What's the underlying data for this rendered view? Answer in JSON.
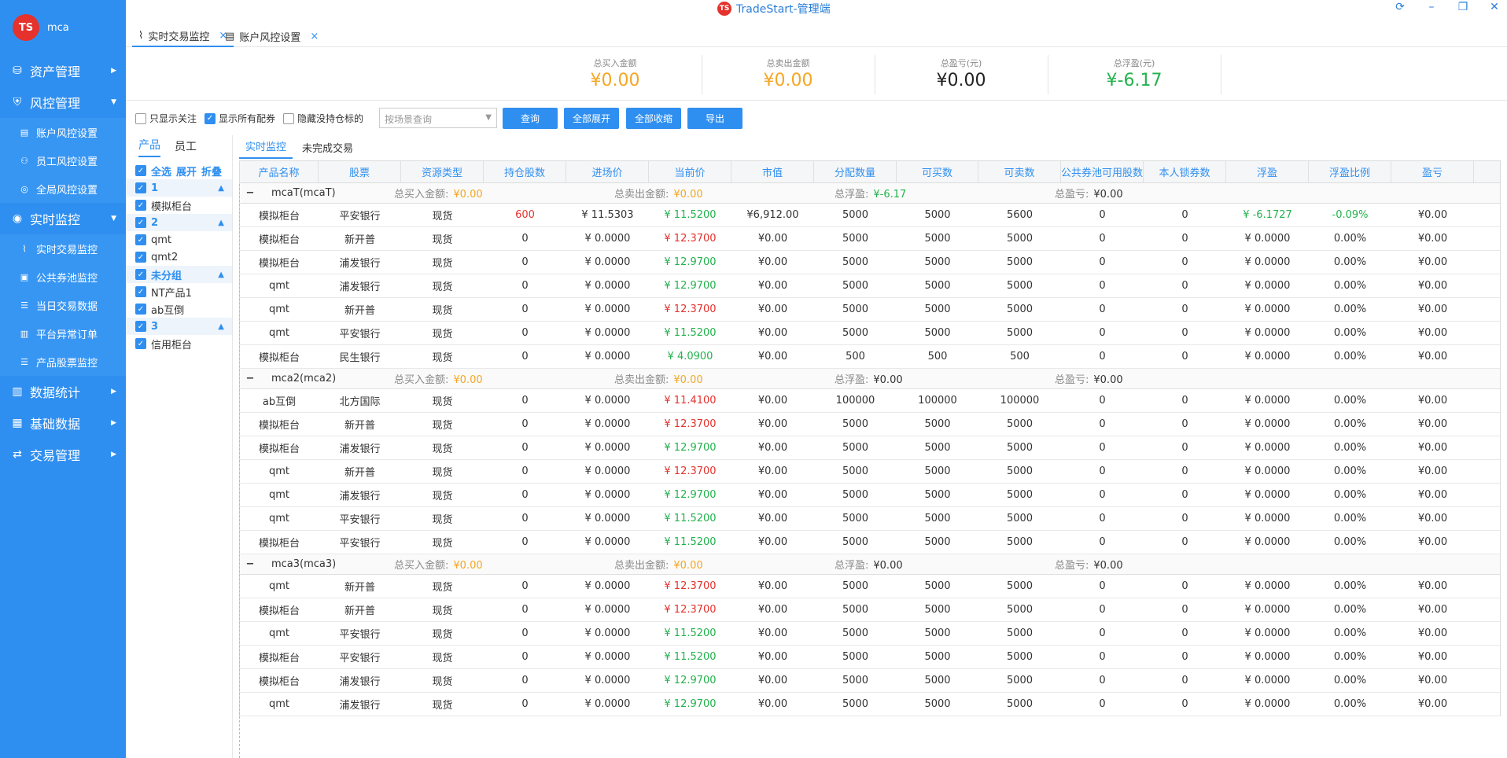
{
  "window": {
    "title": "TradeStart-管理端",
    "logo": "TS",
    "controls": [
      "refresh-icon",
      "minimize-icon",
      "restore-icon",
      "close-icon"
    ],
    "control_glyphs": [
      "⟳",
      "–",
      "❐",
      "✕"
    ]
  },
  "brand": {
    "logo": "TS",
    "name": "mca"
  },
  "sidebar": {
    "groups": [
      {
        "label": "资产管理",
        "icon": "wallet-icon",
        "glyph": "⛁",
        "arrow": "▶",
        "items": []
      },
      {
        "label": "风控管理",
        "icon": "shield-icon",
        "glyph": "⛨",
        "arrow": "▼",
        "items": [
          {
            "label": "账户风控设置",
            "icon": "list-icon",
            "glyph": "▤"
          },
          {
            "label": "员工风控设置",
            "icon": "user-icon",
            "glyph": "⚇"
          },
          {
            "label": "全局风控设置",
            "icon": "globe-icon",
            "glyph": "◎"
          }
        ]
      },
      {
        "label": "实时监控",
        "icon": "monitor-icon",
        "glyph": "◉",
        "arrow": "▼",
        "items": [
          {
            "label": "实时交易监控",
            "icon": "line-chart-icon",
            "glyph": "⌇"
          },
          {
            "label": "公共券池监控",
            "icon": "chart-icon",
            "glyph": "▣"
          },
          {
            "label": "当日交易数据",
            "icon": "list-icon",
            "glyph": "☰"
          },
          {
            "label": "平台异常订单",
            "icon": "order-icon",
            "glyph": "▥"
          },
          {
            "label": "产品股票监控",
            "icon": "list-icon",
            "glyph": "☰"
          }
        ]
      },
      {
        "label": "数据统计",
        "icon": "bar-chart-icon",
        "glyph": "▥",
        "arrow": "▶",
        "items": []
      },
      {
        "label": "基础数据",
        "icon": "database-icon",
        "glyph": "▦",
        "arrow": "▶",
        "items": []
      },
      {
        "label": "交易管理",
        "icon": "exchange-icon",
        "glyph": "⇄",
        "arrow": "▶",
        "items": []
      }
    ]
  },
  "tabs": [
    {
      "label": "实时交易监控",
      "icon": "line-chart-icon",
      "glyph": "⌇",
      "close": "×"
    },
    {
      "label": "账户风控设置",
      "icon": "list-icon",
      "glyph": "▤",
      "close": "×"
    }
  ],
  "summary": [
    {
      "label": "总买入金额",
      "value": "¥0.00",
      "color": "#f5a623"
    },
    {
      "label": "总卖出金额",
      "value": "¥0.00",
      "color": "#f5a623"
    },
    {
      "label": "总盈亏(元)",
      "value": "¥0.00",
      "color": "#222222"
    },
    {
      "label": "总浮盈(元)",
      "value": "¥-6.17",
      "color": "#22b24c"
    }
  ],
  "toolbar": {
    "checks": [
      {
        "label": "只显示关注",
        "checked": false
      },
      {
        "label": "显示所有配券",
        "checked": true
      },
      {
        "label": "隐藏没持仓标的",
        "checked": false
      }
    ],
    "select_placeholder": "按场景查询",
    "select_caret": "▼",
    "check_glyph": "✓",
    "buttons": [
      "查询",
      "全部展开",
      "全部收缩",
      "导出"
    ]
  },
  "filter": {
    "tabs": [
      "产品",
      "员工"
    ],
    "top": {
      "all": "全选",
      "expand": "展开",
      "collapse": "折叠"
    },
    "group_caret": "▲",
    "groups": [
      {
        "name": "1",
        "items": [
          "模拟柜台"
        ]
      },
      {
        "name": "2",
        "items": [
          "qmt",
          "qmt2"
        ]
      },
      {
        "name": "未分组",
        "items": [
          "NT产品1",
          "ab互倒"
        ]
      },
      {
        "name": "3",
        "items": [
          "信用柜台"
        ]
      }
    ]
  },
  "grid": {
    "tabs": [
      "实时监控",
      "未完成交易"
    ],
    "columns": [
      "产品名称",
      "股票",
      "资源类型",
      "持仓股数",
      "进场价",
      "当前价",
      "市值",
      "分配数量",
      "可买数",
      "可卖数",
      "公共券池可用股数",
      "本人锁券数",
      "浮盈",
      "浮盈比例",
      "盈亏"
    ],
    "group_labels": {
      "buy": "总买入金额:",
      "sell": "总卖出金额:",
      "float": "总浮盈:",
      "pnl": "总盈亏:"
    },
    "toggle": "−",
    "groups": [
      {
        "name": "mcaT(mcaT)",
        "buy": "¥0.00",
        "sell": "¥0.00",
        "float": "¥-6.17",
        "float_color": "green",
        "pnl": "¥0.00",
        "rows": [
          [
            "模拟柜台",
            "平安银行",
            "现货",
            "600",
            "¥ 11.5303",
            "¥ 11.5200",
            "¥6,912.00",
            "5000",
            "5000",
            "5600",
            "0",
            "0",
            "¥ -6.1727",
            "-0.09%",
            "¥0.00"
          ],
          [
            "模拟柜台",
            "新开普",
            "现货",
            "0",
            "¥ 0.0000",
            "¥ 12.3700",
            "¥0.00",
            "5000",
            "5000",
            "5000",
            "0",
            "0",
            "¥ 0.0000",
            "0.00%",
            "¥0.00"
          ],
          [
            "模拟柜台",
            "浦发银行",
            "现货",
            "0",
            "¥ 0.0000",
            "¥ 12.9700",
            "¥0.00",
            "5000",
            "5000",
            "5000",
            "0",
            "0",
            "¥ 0.0000",
            "0.00%",
            "¥0.00"
          ],
          [
            "qmt",
            "浦发银行",
            "现货",
            "0",
            "¥ 0.0000",
            "¥ 12.9700",
            "¥0.00",
            "5000",
            "5000",
            "5000",
            "0",
            "0",
            "¥ 0.0000",
            "0.00%",
            "¥0.00"
          ],
          [
            "qmt",
            "新开普",
            "现货",
            "0",
            "¥ 0.0000",
            "¥ 12.3700",
            "¥0.00",
            "5000",
            "5000",
            "5000",
            "0",
            "0",
            "¥ 0.0000",
            "0.00%",
            "¥0.00"
          ],
          [
            "qmt",
            "平安银行",
            "现货",
            "0",
            "¥ 0.0000",
            "¥ 11.5200",
            "¥0.00",
            "5000",
            "5000",
            "5000",
            "0",
            "0",
            "¥ 0.0000",
            "0.00%",
            "¥0.00"
          ],
          [
            "模拟柜台",
            "民生银行",
            "现货",
            "0",
            "¥ 0.0000",
            "¥ 4.0900",
            "¥0.00",
            "500",
            "500",
            "500",
            "0",
            "0",
            "¥ 0.0000",
            "0.00%",
            "¥0.00"
          ]
        ],
        "price_colors": [
          "green",
          "red",
          "green",
          "green",
          "red",
          "green",
          "green"
        ]
      },
      {
        "name": "mca2(mca2)",
        "buy": "¥0.00",
        "sell": "¥0.00",
        "float": "¥0.00",
        "float_color": "",
        "pnl": "¥0.00",
        "rows": [
          [
            "ab互倒",
            "北方国际",
            "现货",
            "0",
            "¥ 0.0000",
            "¥ 11.4100",
            "¥0.00",
            "100000",
            "100000",
            "100000",
            "0",
            "0",
            "¥ 0.0000",
            "0.00%",
            "¥0.00"
          ],
          [
            "模拟柜台",
            "新开普",
            "现货",
            "0",
            "¥ 0.0000",
            "¥ 12.3700",
            "¥0.00",
            "5000",
            "5000",
            "5000",
            "0",
            "0",
            "¥ 0.0000",
            "0.00%",
            "¥0.00"
          ],
          [
            "模拟柜台",
            "浦发银行",
            "现货",
            "0",
            "¥ 0.0000",
            "¥ 12.9700",
            "¥0.00",
            "5000",
            "5000",
            "5000",
            "0",
            "0",
            "¥ 0.0000",
            "0.00%",
            "¥0.00"
          ],
          [
            "qmt",
            "新开普",
            "现货",
            "0",
            "¥ 0.0000",
            "¥ 12.3700",
            "¥0.00",
            "5000",
            "5000",
            "5000",
            "0",
            "0",
            "¥ 0.0000",
            "0.00%",
            "¥0.00"
          ],
          [
            "qmt",
            "浦发银行",
            "现货",
            "0",
            "¥ 0.0000",
            "¥ 12.9700",
            "¥0.00",
            "5000",
            "5000",
            "5000",
            "0",
            "0",
            "¥ 0.0000",
            "0.00%",
            "¥0.00"
          ],
          [
            "qmt",
            "平安银行",
            "现货",
            "0",
            "¥ 0.0000",
            "¥ 11.5200",
            "¥0.00",
            "5000",
            "5000",
            "5000",
            "0",
            "0",
            "¥ 0.0000",
            "0.00%",
            "¥0.00"
          ],
          [
            "模拟柜台",
            "平安银行",
            "现货",
            "0",
            "¥ 0.0000",
            "¥ 11.5200",
            "¥0.00",
            "5000",
            "5000",
            "5000",
            "0",
            "0",
            "¥ 0.0000",
            "0.00%",
            "¥0.00"
          ]
        ],
        "price_colors": [
          "red",
          "red",
          "green",
          "red",
          "green",
          "green",
          "green"
        ]
      },
      {
        "name": "mca3(mca3)",
        "buy": "¥0.00",
        "sell": "¥0.00",
        "float": "¥0.00",
        "float_color": "",
        "pnl": "¥0.00",
        "rows": [
          [
            "qmt",
            "新开普",
            "现货",
            "0",
            "¥ 0.0000",
            "¥ 12.3700",
            "¥0.00",
            "5000",
            "5000",
            "5000",
            "0",
            "0",
            "¥ 0.0000",
            "0.00%",
            "¥0.00"
          ],
          [
            "模拟柜台",
            "新开普",
            "现货",
            "0",
            "¥ 0.0000",
            "¥ 12.3700",
            "¥0.00",
            "5000",
            "5000",
            "5000",
            "0",
            "0",
            "¥ 0.0000",
            "0.00%",
            "¥0.00"
          ],
          [
            "qmt",
            "平安银行",
            "现货",
            "0",
            "¥ 0.0000",
            "¥ 11.5200",
            "¥0.00",
            "5000",
            "5000",
            "5000",
            "0",
            "0",
            "¥ 0.0000",
            "0.00%",
            "¥0.00"
          ],
          [
            "模拟柜台",
            "平安银行",
            "现货",
            "0",
            "¥ 0.0000",
            "¥ 11.5200",
            "¥0.00",
            "5000",
            "5000",
            "5000",
            "0",
            "0",
            "¥ 0.0000",
            "0.00%",
            "¥0.00"
          ],
          [
            "模拟柜台",
            "浦发银行",
            "现货",
            "0",
            "¥ 0.0000",
            "¥ 12.9700",
            "¥0.00",
            "5000",
            "5000",
            "5000",
            "0",
            "0",
            "¥ 0.0000",
            "0.00%",
            "¥0.00"
          ],
          [
            "qmt",
            "浦发银行",
            "现货",
            "0",
            "¥ 0.0000",
            "¥ 12.9700",
            "¥0.00",
            "5000",
            "5000",
            "5000",
            "0",
            "0",
            "¥ 0.0000",
            "0.00%",
            "¥0.00"
          ]
        ],
        "price_colors": [
          "red",
          "red",
          "green",
          "green",
          "green",
          "green"
        ]
      }
    ]
  }
}
